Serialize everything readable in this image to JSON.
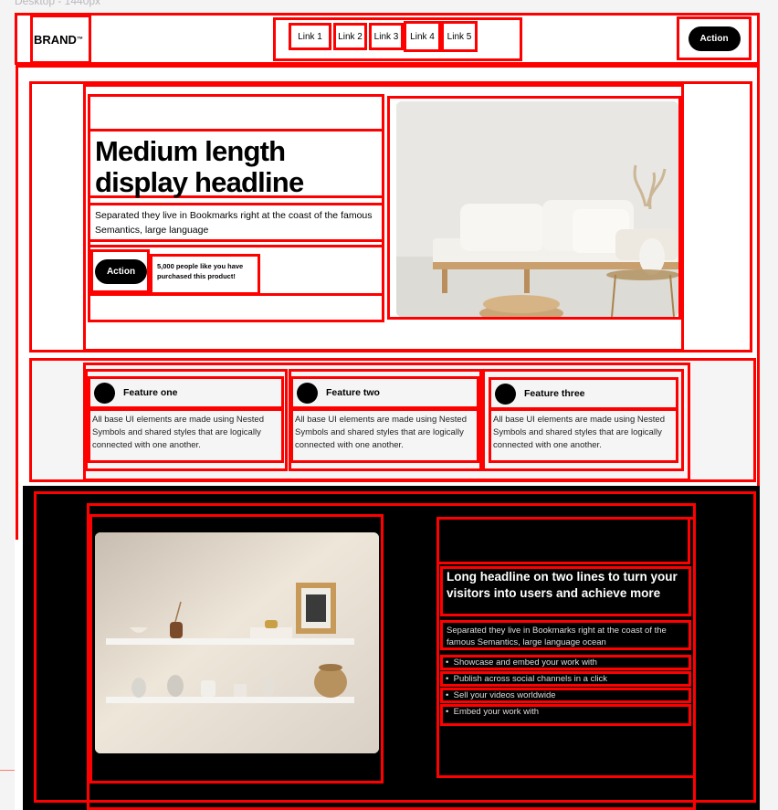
{
  "frame_label": "Desktop - 1440px",
  "nav": {
    "brand": "BRAND",
    "brand_mark": "™",
    "links": [
      "Link 1",
      "Link 2",
      "Link 3",
      "Link 4",
      "Link 5"
    ],
    "action_label": "Action"
  },
  "hero": {
    "headline": "Medium length display headline",
    "subtext": "Separated they live in Bookmarks right at the coast of the famous Semantics, large language",
    "action_label": "Action",
    "social_proof": "5,000 people like you have purchased this product!",
    "image": "sofa-living-room-photo"
  },
  "features": [
    {
      "title": "Feature one",
      "body": "All base UI elements are made using Nested Symbols and shared styles that are logically connected with one another."
    },
    {
      "title": "Feature two",
      "body": "All base UI elements are made using Nested Symbols and shared styles that are logically connected with one another."
    },
    {
      "title": "Feature three",
      "body": "All base UI elements are made using Nested Symbols and shared styles that are logically connected with one another."
    }
  ],
  "showcase": {
    "image": "wall-shelves-decor-photo",
    "headline": "Long headline on two lines to turn your visitors into users and achieve more",
    "subtext": "Separated they live in Bookmarks right at the coast of the famous Semantics, large language ocean",
    "bullets": [
      "Showcase and embed your work with",
      "Publish across social channels in a click",
      "Sell your videos worldwide",
      "Embed your work with"
    ]
  },
  "colors": {
    "annotation": "#ff0000",
    "dark_bg": "#000000",
    "accent": "#000000"
  }
}
